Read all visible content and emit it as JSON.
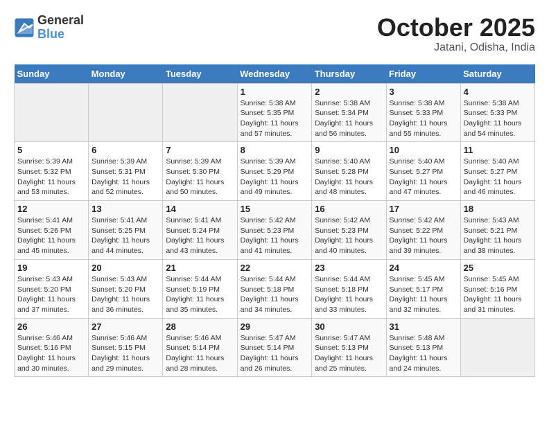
{
  "header": {
    "logo": {
      "general": "General",
      "blue": "Blue"
    },
    "title": "October 2025",
    "location": "Jatani, Odisha, India"
  },
  "calendar": {
    "weekdays": [
      "Sunday",
      "Monday",
      "Tuesday",
      "Wednesday",
      "Thursday",
      "Friday",
      "Saturday"
    ],
    "weeks": [
      [
        {
          "day": "",
          "info": ""
        },
        {
          "day": "",
          "info": ""
        },
        {
          "day": "",
          "info": ""
        },
        {
          "day": "1",
          "info": "Sunrise: 5:38 AM\nSunset: 5:35 PM\nDaylight: 11 hours\nand 57 minutes."
        },
        {
          "day": "2",
          "info": "Sunrise: 5:38 AM\nSunset: 5:34 PM\nDaylight: 11 hours\nand 56 minutes."
        },
        {
          "day": "3",
          "info": "Sunrise: 5:38 AM\nSunset: 5:33 PM\nDaylight: 11 hours\nand 55 minutes."
        },
        {
          "day": "4",
          "info": "Sunrise: 5:38 AM\nSunset: 5:33 PM\nDaylight: 11 hours\nand 54 minutes."
        }
      ],
      [
        {
          "day": "5",
          "info": "Sunrise: 5:39 AM\nSunset: 5:32 PM\nDaylight: 11 hours\nand 53 minutes."
        },
        {
          "day": "6",
          "info": "Sunrise: 5:39 AM\nSunset: 5:31 PM\nDaylight: 11 hours\nand 52 minutes."
        },
        {
          "day": "7",
          "info": "Sunrise: 5:39 AM\nSunset: 5:30 PM\nDaylight: 11 hours\nand 50 minutes."
        },
        {
          "day": "8",
          "info": "Sunrise: 5:39 AM\nSunset: 5:29 PM\nDaylight: 11 hours\nand 49 minutes."
        },
        {
          "day": "9",
          "info": "Sunrise: 5:40 AM\nSunset: 5:28 PM\nDaylight: 11 hours\nand 48 minutes."
        },
        {
          "day": "10",
          "info": "Sunrise: 5:40 AM\nSunset: 5:27 PM\nDaylight: 11 hours\nand 47 minutes."
        },
        {
          "day": "11",
          "info": "Sunrise: 5:40 AM\nSunset: 5:27 PM\nDaylight: 11 hours\nand 46 minutes."
        }
      ],
      [
        {
          "day": "12",
          "info": "Sunrise: 5:41 AM\nSunset: 5:26 PM\nDaylight: 11 hours\nand 45 minutes."
        },
        {
          "day": "13",
          "info": "Sunrise: 5:41 AM\nSunset: 5:25 PM\nDaylight: 11 hours\nand 44 minutes."
        },
        {
          "day": "14",
          "info": "Sunrise: 5:41 AM\nSunset: 5:24 PM\nDaylight: 11 hours\nand 43 minutes."
        },
        {
          "day": "15",
          "info": "Sunrise: 5:42 AM\nSunset: 5:23 PM\nDaylight: 11 hours\nand 41 minutes."
        },
        {
          "day": "16",
          "info": "Sunrise: 5:42 AM\nSunset: 5:23 PM\nDaylight: 11 hours\nand 40 minutes."
        },
        {
          "day": "17",
          "info": "Sunrise: 5:42 AM\nSunset: 5:22 PM\nDaylight: 11 hours\nand 39 minutes."
        },
        {
          "day": "18",
          "info": "Sunrise: 5:43 AM\nSunset: 5:21 PM\nDaylight: 11 hours\nand 38 minutes."
        }
      ],
      [
        {
          "day": "19",
          "info": "Sunrise: 5:43 AM\nSunset: 5:20 PM\nDaylight: 11 hours\nand 37 minutes."
        },
        {
          "day": "20",
          "info": "Sunrise: 5:43 AM\nSunset: 5:20 PM\nDaylight: 11 hours\nand 36 minutes."
        },
        {
          "day": "21",
          "info": "Sunrise: 5:44 AM\nSunset: 5:19 PM\nDaylight: 11 hours\nand 35 minutes."
        },
        {
          "day": "22",
          "info": "Sunrise: 5:44 AM\nSunset: 5:18 PM\nDaylight: 11 hours\nand 34 minutes."
        },
        {
          "day": "23",
          "info": "Sunrise: 5:44 AM\nSunset: 5:18 PM\nDaylight: 11 hours\nand 33 minutes."
        },
        {
          "day": "24",
          "info": "Sunrise: 5:45 AM\nSunset: 5:17 PM\nDaylight: 11 hours\nand 32 minutes."
        },
        {
          "day": "25",
          "info": "Sunrise: 5:45 AM\nSunset: 5:16 PM\nDaylight: 11 hours\nand 31 minutes."
        }
      ],
      [
        {
          "day": "26",
          "info": "Sunrise: 5:46 AM\nSunset: 5:16 PM\nDaylight: 11 hours\nand 30 minutes."
        },
        {
          "day": "27",
          "info": "Sunrise: 5:46 AM\nSunset: 5:15 PM\nDaylight: 11 hours\nand 29 minutes."
        },
        {
          "day": "28",
          "info": "Sunrise: 5:46 AM\nSunset: 5:14 PM\nDaylight: 11 hours\nand 28 minutes."
        },
        {
          "day": "29",
          "info": "Sunrise: 5:47 AM\nSunset: 5:14 PM\nDaylight: 11 hours\nand 26 minutes."
        },
        {
          "day": "30",
          "info": "Sunrise: 5:47 AM\nSunset: 5:13 PM\nDaylight: 11 hours\nand 25 minutes."
        },
        {
          "day": "31",
          "info": "Sunrise: 5:48 AM\nSunset: 5:13 PM\nDaylight: 11 hours\nand 24 minutes."
        },
        {
          "day": "",
          "info": ""
        }
      ]
    ]
  }
}
